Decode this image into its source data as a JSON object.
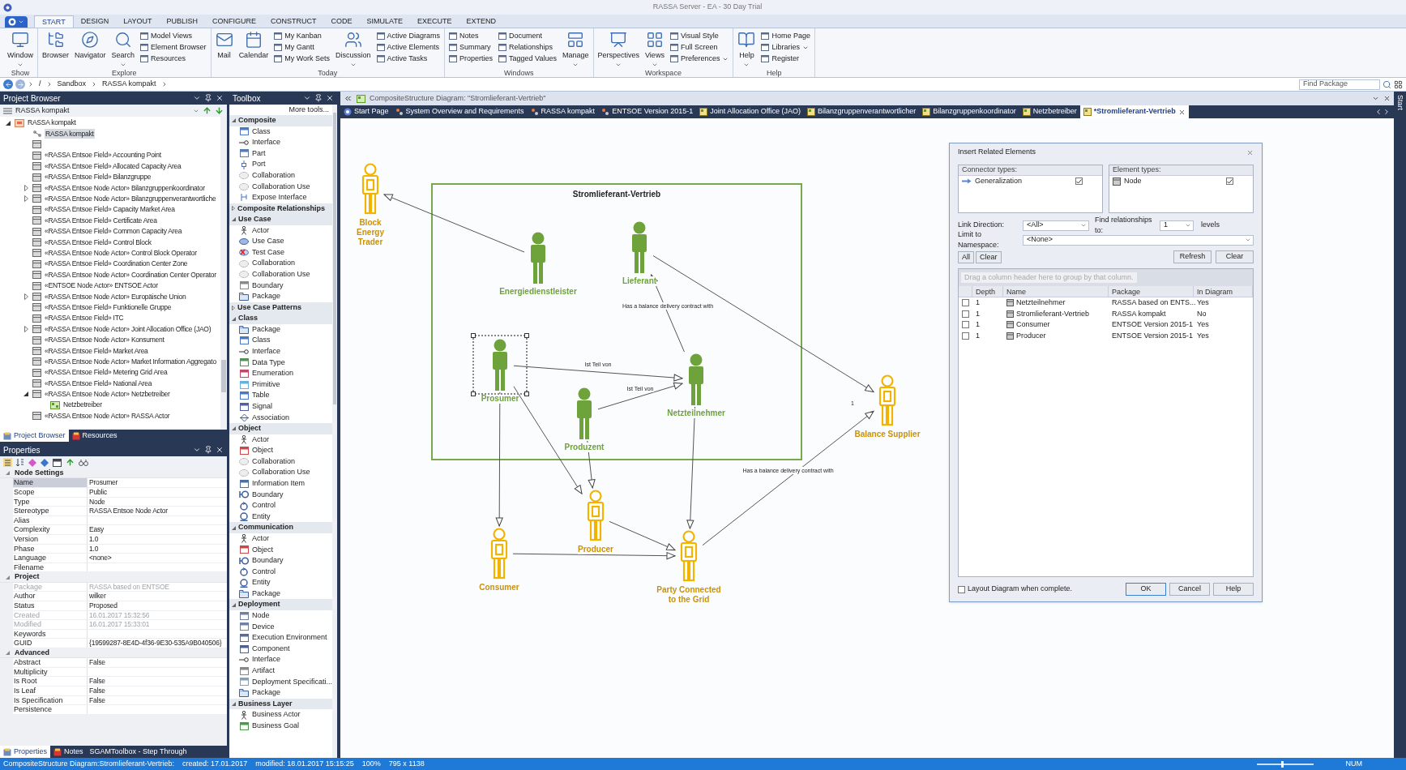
{
  "window": {
    "title": "RASSA Server - EA - 30 Day Trial"
  },
  "ribbon": {
    "tabs": [
      {
        "label": "START",
        "selected": true
      },
      {
        "label": "DESIGN",
        "selected": false
      },
      {
        "label": "LAYOUT",
        "selected": false
      },
      {
        "label": "PUBLISH",
        "selected": false
      },
      {
        "label": "CONFIGURE",
        "selected": false
      },
      {
        "label": "CONSTRUCT",
        "selected": false
      },
      {
        "label": "CODE",
        "selected": false
      },
      {
        "label": "SIMULATE",
        "selected": false
      },
      {
        "label": "EXECUTE",
        "selected": false
      },
      {
        "label": "EXTEND",
        "selected": false
      }
    ],
    "groups": [
      {
        "label": "Show",
        "items": [
          {
            "label": "Window",
            "kind": "large",
            "dropdown": true
          }
        ]
      },
      {
        "label": "Explore",
        "items": [
          {
            "label": "Browser",
            "kind": "large",
            "dropdown": false
          },
          {
            "label": "Navigator",
            "kind": "large",
            "dropdown": false
          },
          {
            "label": "Search",
            "kind": "large",
            "dropdown": true
          },
          {
            "label": "Model Views",
            "kind": "small",
            "dropdown": false
          },
          {
            "label": "Element Browser",
            "kind": "small",
            "dropdown": false
          },
          {
            "label": "Resources",
            "kind": "small",
            "dropdown": false
          }
        ]
      },
      {
        "label": "Today",
        "items": [
          {
            "label": "Mail",
            "kind": "large",
            "dropdown": false
          },
          {
            "label": "Calendar",
            "kind": "large",
            "dropdown": false
          },
          {
            "label": "My Kanban",
            "kind": "small",
            "dropdown": false
          },
          {
            "label": "My Gantt",
            "kind": "small",
            "dropdown": false
          },
          {
            "label": "My Work Sets",
            "kind": "small",
            "dropdown": false
          },
          {
            "label": "Discussion",
            "kind": "large",
            "dropdown": true
          },
          {
            "label": "Active Diagrams",
            "kind": "small",
            "dropdown": false
          },
          {
            "label": "Active Elements",
            "kind": "small",
            "dropdown": false
          },
          {
            "label": "Active Tasks",
            "kind": "small",
            "dropdown": false
          }
        ]
      },
      {
        "label": "Windows",
        "items": [
          {
            "label": "Notes",
            "kind": "small",
            "dropdown": false
          },
          {
            "label": "Summary",
            "kind": "small",
            "dropdown": false
          },
          {
            "label": "Properties",
            "kind": "small",
            "dropdown": false
          },
          {
            "label": "Document",
            "kind": "small",
            "dropdown": false
          },
          {
            "label": "Relationships",
            "kind": "small",
            "dropdown": false
          },
          {
            "label": "Tagged Values",
            "kind": "small",
            "dropdown": false
          },
          {
            "label": "Manage",
            "kind": "large",
            "dropdown": true
          }
        ]
      },
      {
        "label": "Workspace",
        "items": [
          {
            "label": "Perspectives",
            "kind": "large",
            "dropdown": true
          },
          {
            "label": "Views",
            "kind": "large",
            "dropdown": true
          },
          {
            "label": "Visual Style",
            "kind": "small",
            "dropdown": false
          },
          {
            "label": "Full Screen",
            "kind": "small",
            "dropdown": false
          },
          {
            "label": "Preferences",
            "kind": "small",
            "dropdown": true
          }
        ]
      },
      {
        "label": "Help",
        "items": [
          {
            "label": "Help",
            "kind": "large",
            "dropdown": true
          },
          {
            "label": "Home Page",
            "kind": "small",
            "dropdown": false
          },
          {
            "label": "Libraries",
            "kind": "small",
            "dropdown": true
          },
          {
            "label": "Register",
            "kind": "small",
            "dropdown": false
          }
        ]
      }
    ]
  },
  "address_bar": {
    "path": [
      "/",
      "Sandbox",
      "RASSA kompakt"
    ],
    "search": {
      "placeholder": "Find Package"
    }
  },
  "project_browser": {
    "title": "Project Browser",
    "root_label": "RASSA kompakt",
    "tree": [
      {
        "label": "RASSA kompakt",
        "kind": "package",
        "expanded": true,
        "selected": false,
        "children": [
          {
            "label": "RASSA kompakt",
            "kind": "diagram",
            "selected": true
          },
          {
            "kind": "element",
            "selected": false
          },
          {
            "label": "«RASSA Entsoe Field» Accounting Point",
            "kind": "element",
            "selected": false
          },
          {
            "label": "«RASSA Entsoe Field» Allocated Capacity Area",
            "kind": "element",
            "selected": false
          },
          {
            "label": "«RASSA Entsoe Field» Bilanzgruppe",
            "kind": "element",
            "selected": false
          },
          {
            "label": "«RASSA Entsoe Node Actor» Bilanzgruppenkoordinator",
            "kind": "element",
            "expanded": false,
            "selected": false
          },
          {
            "label": "«RASSA Entsoe Node Actor» Bilanzgruppenverantwortliche",
            "kind": "element",
            "expanded": false,
            "selected": false
          },
          {
            "label": "«RASSA Entsoe Field» Capacity Market Area",
            "kind": "element",
            "selected": false
          },
          {
            "label": "«RASSA Entsoe Field» Certificate Area",
            "kind": "element",
            "selected": false
          },
          {
            "label": "«RASSA Entsoe Field» Common Capacity Area",
            "kind": "element",
            "selected": false
          },
          {
            "label": "«RASSA Entsoe Field» Control Block",
            "kind": "element",
            "selected": false
          },
          {
            "label": "«RASSA Entsoe Node Actor» Control Block Operator",
            "kind": "element",
            "selected": false
          },
          {
            "label": "«RASSA Entsoe Field» Coordination Center Zone",
            "kind": "element",
            "selected": false
          },
          {
            "label": "«RASSA Entsoe Node Actor» Coordination Center Operator",
            "kind": "element",
            "selected": false
          },
          {
            "label": "«ENTSOE Node Actor» ENTSOE Actor",
            "kind": "element",
            "selected": false
          },
          {
            "label": "«RASSA Entsoe Node Actor» Europäische Union",
            "kind": "element",
            "expanded": false,
            "selected": false
          },
          {
            "label": "«RASSA Entsoe Field» Funktionelle Gruppe",
            "kind": "element",
            "selected": false
          },
          {
            "label": "«RASSA Entsoe Field» ITC",
            "kind": "element",
            "selected": false
          },
          {
            "label": "«RASSA Entsoe Node Actor» Joint Allocation Office (JAO)",
            "kind": "element",
            "expanded": false,
            "selected": false
          },
          {
            "label": "«RASSA Entsoe Node Actor» Konsument",
            "kind": "element",
            "selected": false
          },
          {
            "label": "«RASSA Entsoe Field» Market Area",
            "kind": "element",
            "selected": false
          },
          {
            "label": "«RASSA Entsoe Node Actor» Market Information Aggregato",
            "kind": "element",
            "selected": false
          },
          {
            "label": "«RASSA Entsoe Field» Metering Grid Area",
            "kind": "element",
            "selected": false
          },
          {
            "label": "«RASSA Entsoe Field» National Area",
            "kind": "element",
            "selected": false
          },
          {
            "label": "«RASSA Entsoe Node Actor» Netzbetreiber",
            "kind": "element",
            "expanded": true,
            "selected": false,
            "children": [
              {
                "label": "Netzbetreiber",
                "kind": "diagram_green",
                "selected": false
              }
            ]
          },
          {
            "label": "«RASSA Entsoe Node Actor» RASSA Actor",
            "kind": "element",
            "selected": false
          }
        ]
      }
    ],
    "tabs": [
      {
        "label": "Project Browser",
        "selected": true
      },
      {
        "label": "Resources",
        "selected": false
      }
    ]
  },
  "properties": {
    "title": "Properties",
    "sections": [
      {
        "title": "Node Settings",
        "expanded": true,
        "rows": [
          {
            "name": "Name",
            "value": "Prosumer",
            "selected": true,
            "disabled": false
          },
          {
            "name": "Scope",
            "value": "Public",
            "selected": false,
            "disabled": false
          },
          {
            "name": "Type",
            "value": "Node",
            "selected": false,
            "disabled": false
          },
          {
            "name": "Stereotype",
            "value": "RASSA Entsoe Node Actor",
            "selected": false,
            "disabled": false
          },
          {
            "name": "Alias",
            "selected": false,
            "disabled": false
          },
          {
            "name": "Complexity",
            "value": "Easy",
            "selected": false,
            "disabled": false
          },
          {
            "name": "Version",
            "value": "1.0",
            "selected": false,
            "disabled": false
          },
          {
            "name": "Phase",
            "value": "1.0",
            "selected": false,
            "disabled": false
          },
          {
            "name": "Language",
            "value": "<none>",
            "selected": false,
            "disabled": false
          },
          {
            "name": "Filename",
            "selected": false,
            "disabled": false
          }
        ]
      },
      {
        "title": "Project",
        "expanded": true,
        "rows": [
          {
            "name": "Package",
            "value": "RASSA based on ENTSOE",
            "selected": false,
            "disabled": true
          },
          {
            "name": "Author",
            "value": "wilker",
            "selected": false,
            "disabled": false
          },
          {
            "name": "Status",
            "value": "Proposed",
            "selected": false,
            "disabled": false
          },
          {
            "name": "Created",
            "value": "16.01.2017 15:32:56",
            "selected": false,
            "disabled": true
          },
          {
            "name": "Modified",
            "value": "16.01.2017 15:33:01",
            "selected": false,
            "disabled": true
          },
          {
            "name": "Keywords",
            "selected": false,
            "disabled": false
          },
          {
            "name": "GUID",
            "value": "{19599287-8E4D-4f36-9E30-535A9B040506}",
            "selected": false,
            "disabled": false
          }
        ]
      },
      {
        "title": "Advanced",
        "expanded": true,
        "rows": [
          {
            "name": "Abstract",
            "value": "False",
            "selected": false,
            "disabled": false
          },
          {
            "name": "Multiplicity",
            "selected": false,
            "disabled": false
          },
          {
            "name": "Is Root",
            "value": "False",
            "selected": false,
            "disabled": false
          },
          {
            "name": "Is Leaf",
            "value": "False",
            "selected": false,
            "disabled": false
          },
          {
            "name": "Is Specification",
            "value": "False",
            "selected": false,
            "disabled": false
          },
          {
            "name": "Persistence",
            "selected": false,
            "disabled": false
          }
        ]
      }
    ],
    "tabs": [
      {
        "label": "Properties",
        "selected": true
      },
      {
        "label": "Notes",
        "selected": false
      },
      {
        "label": "SGAMToolbox - Step Through",
        "selected": false
      }
    ]
  },
  "toolbox": {
    "title": "Toolbox",
    "more": "More tools...",
    "sections": [
      {
        "title": "Composite",
        "expanded": true,
        "items": [
          {
            "label": "Class",
            "kind": "class"
          },
          {
            "label": "Interface",
            "kind": "interface"
          },
          {
            "label": "Part",
            "kind": "part"
          },
          {
            "label": "Port",
            "kind": "port"
          },
          {
            "label": "Collaboration",
            "kind": "collaboration"
          },
          {
            "label": "Collaboration Use",
            "kind": "collaboration"
          },
          {
            "label": "Expose Interface",
            "kind": "expose"
          }
        ]
      },
      {
        "title": "Composite Relationships",
        "expanded": false
      },
      {
        "title": "Use Case",
        "expanded": true,
        "items": [
          {
            "label": "Actor",
            "kind": "actor"
          },
          {
            "label": "Use Case",
            "kind": "usecase"
          },
          {
            "label": "Test Case",
            "kind": "testcase"
          },
          {
            "label": "Collaboration",
            "kind": "collaboration"
          },
          {
            "label": "Collaboration Use",
            "kind": "collaboration"
          },
          {
            "label": "Boundary",
            "kind": "boundary"
          },
          {
            "label": "Package",
            "kind": "package"
          }
        ]
      },
      {
        "title": "Use Case Patterns",
        "expanded": false
      },
      {
        "title": "Class",
        "expanded": true,
        "items": [
          {
            "label": "Package",
            "kind": "package"
          },
          {
            "label": "Class",
            "kind": "class"
          },
          {
            "label": "Interface",
            "kind": "interface"
          },
          {
            "label": "Data Type",
            "kind": "datatype"
          },
          {
            "label": "Enumeration",
            "kind": "enumeration"
          },
          {
            "label": "Primitive",
            "kind": "primitive"
          },
          {
            "label": "Table",
            "kind": "table"
          },
          {
            "label": "Signal",
            "kind": "signal"
          },
          {
            "label": "Association",
            "kind": "association"
          }
        ]
      },
      {
        "title": "Object",
        "expanded": true,
        "items": [
          {
            "label": "Actor",
            "kind": "actor"
          },
          {
            "label": "Object",
            "kind": "object"
          },
          {
            "label": "Collaboration",
            "kind": "collaboration"
          },
          {
            "label": "Collaboration Use",
            "kind": "collaboration"
          },
          {
            "label": "Information Item",
            "kind": "infoitem"
          },
          {
            "label": "Boundary",
            "kind": "boundary_ui"
          },
          {
            "label": "Control",
            "kind": "control"
          },
          {
            "label": "Entity",
            "kind": "entity"
          }
        ]
      },
      {
        "title": "Communication",
        "expanded": true,
        "items": [
          {
            "label": "Actor",
            "kind": "actor"
          },
          {
            "label": "Object",
            "kind": "object"
          },
          {
            "label": "Boundary",
            "kind": "boundary_ui"
          },
          {
            "label": "Control",
            "kind": "control"
          },
          {
            "label": "Entity",
            "kind": "entity"
          },
          {
            "label": "Package",
            "kind": "package"
          }
        ]
      },
      {
        "title": "Deployment",
        "expanded": true,
        "items": [
          {
            "label": "Node",
            "kind": "node"
          },
          {
            "label": "Device",
            "kind": "device"
          },
          {
            "label": "Execution Environment",
            "kind": "exec"
          },
          {
            "label": "Component",
            "kind": "component"
          },
          {
            "label": "Interface",
            "kind": "interface"
          },
          {
            "label": "Artifact",
            "kind": "artifact"
          },
          {
            "label": "Deployment Specificati...",
            "kind": "deployspec"
          },
          {
            "label": "Package",
            "kind": "package"
          }
        ]
      },
      {
        "title": "Business Layer",
        "expanded": true,
        "items": [
          {
            "label": "Business Actor",
            "kind": "actor"
          },
          {
            "label": "Business Goal",
            "kind": "goal"
          }
        ]
      }
    ]
  },
  "diagram": {
    "title": "CompositeStructure Diagram: \"Stromlieferant-Vertrieb\"",
    "tabs": [
      {
        "label": "Start Page",
        "kind": "start",
        "selected": false
      },
      {
        "label": "System Overview and Requirements",
        "kind": "model",
        "selected": false
      },
      {
        "label": "RASSA kompakt",
        "kind": "model",
        "selected": false
      },
      {
        "label": "ENTSOE Version 2015-1",
        "kind": "model",
        "selected": false
      },
      {
        "label": "Joint Allocation Office (JAO)",
        "kind": "diagram",
        "selected": false
      },
      {
        "label": "Bilanzgruppenverantwortlicher",
        "kind": "diagram",
        "selected": false
      },
      {
        "label": "Bilanzgruppenkoordinator",
        "kind": "diagram",
        "selected": false
      },
      {
        "label": "Netzbetreiber",
        "kind": "diagram",
        "selected": false
      },
      {
        "label": "*Stromlieferant-Vertrieb",
        "kind": "diagram",
        "selected": true
      }
    ],
    "frame": {
      "title": "Stromlieferant-Vertrieb"
    },
    "nodes": [
      {
        "label": "Block Energy Trader",
        "kind": "outlined",
        "selected": false
      },
      {
        "label": "Energiedienstleister",
        "kind": "filled",
        "selected": false
      },
      {
        "label": "Lieferant",
        "kind": "filled",
        "selected": false
      },
      {
        "label": "Prosumer",
        "kind": "filled",
        "selected": true
      },
      {
        "label": "Netzteilnehmer",
        "kind": "filled",
        "selected": false
      },
      {
        "label": "Produzent",
        "kind": "filled",
        "selected": false
      },
      {
        "label": "Balance Supplier",
        "kind": "outlined",
        "selected": false
      },
      {
        "label": "Producer",
        "kind": "outlined",
        "selected": false
      },
      {
        "label": "Consumer",
        "kind": "outlined",
        "selected": false
      },
      {
        "label": "Party Connected to the Grid",
        "kind": "outlined",
        "selected": false
      }
    ],
    "connector_labels": [
      {
        "label": "Has a balance delivery contract with"
      },
      {
        "label": "Ist Teil von"
      },
      {
        "label": "Ist Teil von"
      },
      {
        "label": "Has a balance delivery contract with",
        "multiplicity": "1"
      }
    ]
  },
  "dialog": {
    "title": "Insert Related Elements",
    "connector_types": {
      "header": "Connector types:",
      "items": [
        {
          "label": "Generalization",
          "checked": true
        }
      ]
    },
    "element_types": {
      "header": "Element types:",
      "items": [
        {
          "label": "Node",
          "checked": true
        }
      ]
    },
    "link_direction": {
      "label": "Link Direction:",
      "value": "<All>"
    },
    "find_relationships": {
      "label": "Find relationships to:",
      "value": "1",
      "suffix": "levels"
    },
    "namespace": {
      "label": "Limit to Namespace:",
      "value": "<None>"
    },
    "select_buttons": [
      "All",
      "Clear"
    ],
    "action_buttons": [
      "Refresh",
      "Clear"
    ],
    "group_hint": "Drag a column header here to group by that column.",
    "columns": [
      "Depth",
      "Name",
      "Package",
      "In Diagram"
    ],
    "rows": [
      {
        "checked": false,
        "depth": "1",
        "name": "Netzteilnehmer",
        "package": "RASSA based on ENTS...",
        "in_diagram": "Yes"
      },
      {
        "checked": false,
        "depth": "1",
        "name": "Stromlieferant-Vertrieb",
        "package": "RASSA kompakt",
        "in_diagram": "No"
      },
      {
        "checked": false,
        "depth": "1",
        "name": "Consumer",
        "package": "ENTSOE Version 2015-1",
        "in_diagram": "Yes"
      },
      {
        "checked": false,
        "depth": "1",
        "name": "Producer",
        "package": "ENTSOE Version 2015-1",
        "in_diagram": "Yes"
      }
    ],
    "layout_option": {
      "label": "Layout Diagram when complete.",
      "checked": false
    },
    "footer_buttons": [
      {
        "label": "OK",
        "default": true
      },
      {
        "label": "Cancel",
        "default": false
      },
      {
        "label": "Help",
        "default": false
      }
    ]
  },
  "side_tab": "Start",
  "status_bar": {
    "items": [
      "CompositeStructure Diagram:Stromlieferant-Vertrieb:",
      "created: 17.01.2017",
      "modified: 18.01.2017 15:15:25",
      "100%",
      "795 x 1138"
    ],
    "zoom_slider": {
      "level": 0.45
    },
    "indicator": "NUM"
  }
}
